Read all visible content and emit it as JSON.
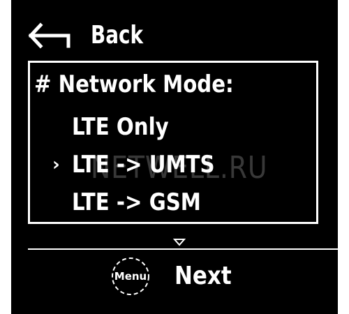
{
  "header": {
    "back_label": "Back",
    "back_icon": "arrow-left-icon"
  },
  "menu": {
    "title": "# Network Mode:",
    "selected_marker": "›",
    "options": [
      {
        "label": "LTE Only",
        "selected": false
      },
      {
        "label": "LTE -> UMTS",
        "selected": true
      },
      {
        "label": "LTE -> GSM",
        "selected": false
      }
    ],
    "scroll_icon": "triangle-down-icon"
  },
  "footer": {
    "menu_button_label": "Menu",
    "next_label": "Next"
  },
  "watermark": "NETWELL.RU",
  "colors": {
    "background": "#000000",
    "foreground": "#ffffff",
    "page": "#ffffff"
  }
}
